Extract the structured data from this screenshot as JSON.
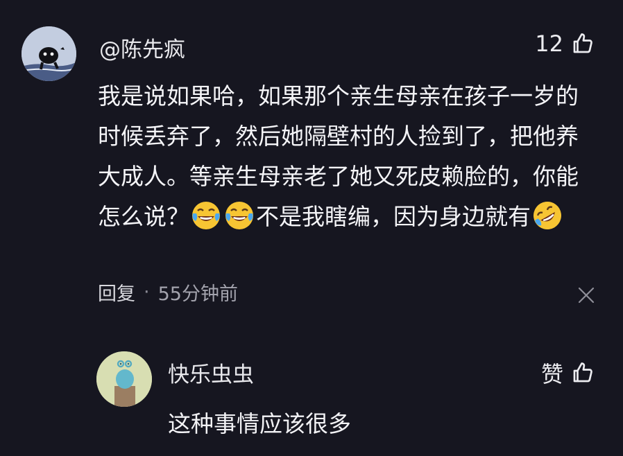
{
  "comment": {
    "username": "@陈先疯",
    "like_count": "12",
    "icons": {
      "like": "thumbs-up-icon",
      "emoji": "face-tears-of-joy-icon"
    },
    "text": {
      "part1": "我是说如果哈，如果那个亲生母亲在孩子一岁的时候丢弃了，然后她隔壁村的人捡到了，把他养大成人。等亲生母亲老了她又死皮赖脸的，你能怎么说？",
      "part2": "不是我瞎编，因为身边就有"
    },
    "reply_action": "回复",
    "separator": "·",
    "time": "55分钟前",
    "dismiss_icon": "close-icon"
  },
  "reply": {
    "username": "快乐虫虫",
    "like_label": "赞",
    "text": "这种事情应该很多"
  },
  "colors": {
    "background": "#161620",
    "text": "#f2f2f5",
    "muted": "#a3a3ad"
  }
}
